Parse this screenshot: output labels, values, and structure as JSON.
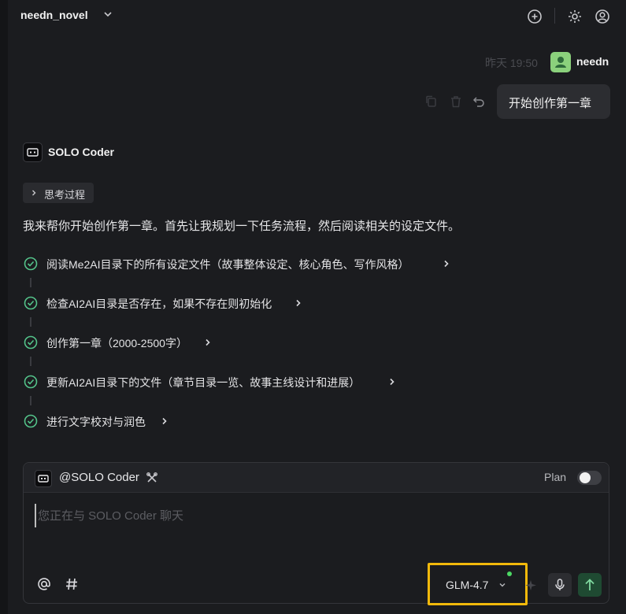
{
  "header": {
    "project_name": "needn_novel",
    "icons": [
      "new-chat-icon",
      "settings-icon",
      "account-icon"
    ]
  },
  "user_message": {
    "timestamp": "昨天 19:50",
    "username": "needn",
    "text": "开始创作第一章",
    "actions": [
      "copy-icon",
      "delete-icon",
      "undo-icon"
    ]
  },
  "agent": {
    "name": "SOLO Coder",
    "thinking_label": "思考过程",
    "intro": "我来帮你开始创作第一章。首先让我规划一下任务流程，然后阅读相关的设定文件。",
    "tasks": [
      {
        "label": "阅读Me2AI目录下的所有设定文件（故事整体设定、核心角色、写作风格）",
        "status": "done"
      },
      {
        "label": "检查AI2AI目录是否存在，如果不存在则初始化",
        "status": "done"
      },
      {
        "label": "创作第一章（2000-2500字）",
        "status": "done"
      },
      {
        "label": "更新AI2AI目录下的文件（章节目录一览、故事主线设计和进展）",
        "status": "done"
      },
      {
        "label": "进行文字校对与润色",
        "status": "done"
      }
    ]
  },
  "composer": {
    "agent_mention": "@SOLO Coder",
    "plan_label": "Plan",
    "plan_enabled": false,
    "input_value": "",
    "placeholder": "您正在与 SOLO Coder 聊天",
    "model": "GLM-4.7",
    "accent_highlight": "#f2b90b",
    "status_color": "#4cd964"
  }
}
